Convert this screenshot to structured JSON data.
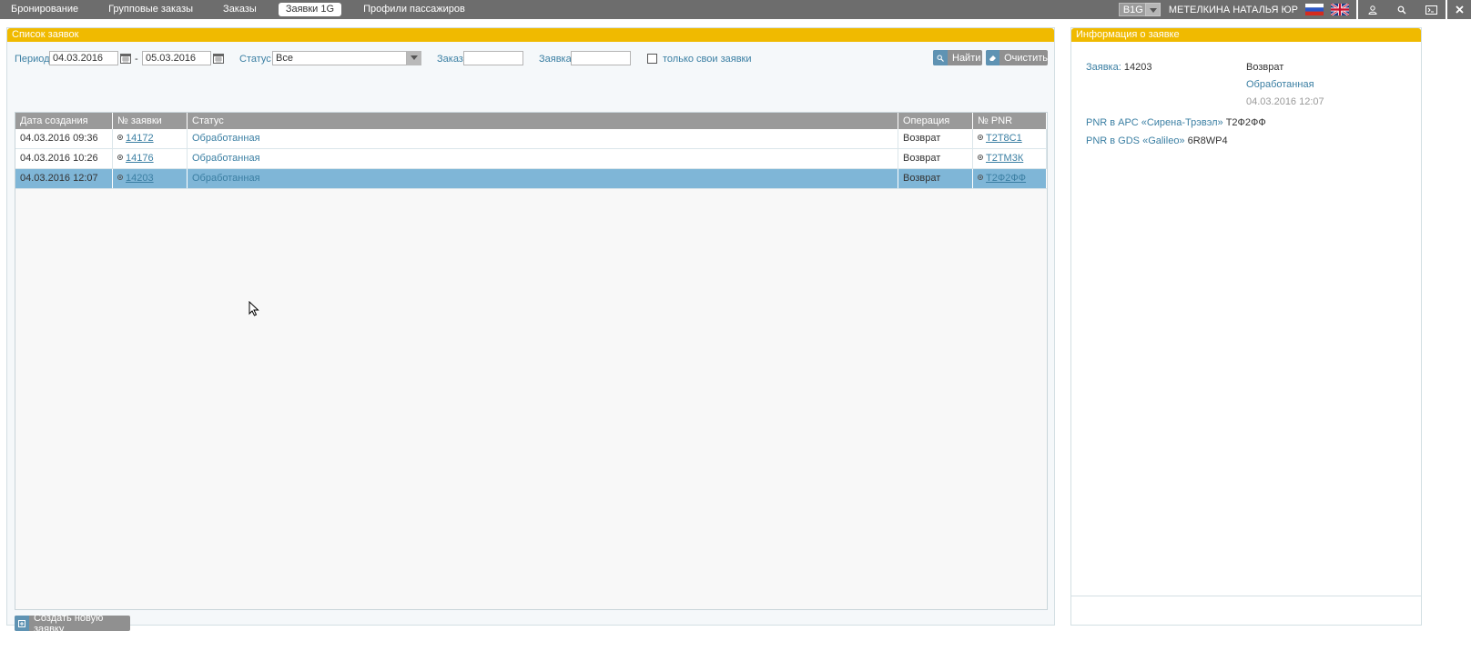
{
  "topnav": {
    "tabs": [
      {
        "label": "Бронирование",
        "active": false
      },
      {
        "label": "Групповые заказы",
        "active": false
      },
      {
        "label": "Заказы",
        "active": false
      },
      {
        "label": "Заявки 1G",
        "active": true
      },
      {
        "label": "Профили пассажиров",
        "active": false
      }
    ],
    "agency_code": "B1G",
    "user_name": "МЕТЕЛКИНА НАТАЛЬЯ ЮР",
    "icons": [
      "ru-flag-icon",
      "uk-flag-icon",
      "user-icon",
      "search-icon",
      "terminal-icon",
      "close-icon"
    ]
  },
  "list_panel": {
    "title": "Список заявок",
    "filters": {
      "period_label": "Период",
      "date_from": "04.03.2016",
      "date_separator": "-",
      "date_to": "05.03.2016",
      "status_label": "Статус",
      "status_value": "Все",
      "order_label": "Заказ",
      "order_value": "",
      "request_label": "Заявка",
      "request_value": "",
      "own_only_label": "только свои заявки",
      "own_only_checked": false,
      "find_label": "Найти",
      "clear_label": "Очистить"
    },
    "table": {
      "columns": [
        "Дата создания",
        "№ заявки",
        "Статус",
        "Операция",
        "№ PNR"
      ],
      "rows": [
        {
          "created": "04.03.2016 09:36",
          "number": "14172",
          "status": "Обработанная",
          "operation": "Возврат",
          "pnr": "Т2Т8С1",
          "selected": false
        },
        {
          "created": "04.03.2016 10:26",
          "number": "14176",
          "status": "Обработанная",
          "operation": "Возврат",
          "pnr": "Т2ТМ3К",
          "selected": false
        },
        {
          "created": "04.03.2016 12:07",
          "number": "14203",
          "status": "Обработанная",
          "operation": "Возврат",
          "pnr": "Т2Ф2ФФ",
          "selected": true
        }
      ]
    },
    "create_label": "Создать новую заявку"
  },
  "info_panel": {
    "title": "Информация о заявке",
    "request_label": "Заявка:",
    "request_number": "14203",
    "operation": "Возврат",
    "status": "Обработанная",
    "datetime": "04.03.2016 12:07",
    "pnr_arc_label": "PNR в АРС «Сирена-Трэвэл»",
    "pnr_arc_value": "Т2Ф2ФФ",
    "pnr_gds_label": "PNR в GDS «Galileo»",
    "pnr_gds_value": "6R8WP4"
  },
  "colors": {
    "topbar": "#6d6d6d",
    "panel_header": "#f0ba00",
    "link_blue": "#3b7fa3",
    "selected_row": "#7fb6d7",
    "button_icon": "#5f93b3"
  }
}
